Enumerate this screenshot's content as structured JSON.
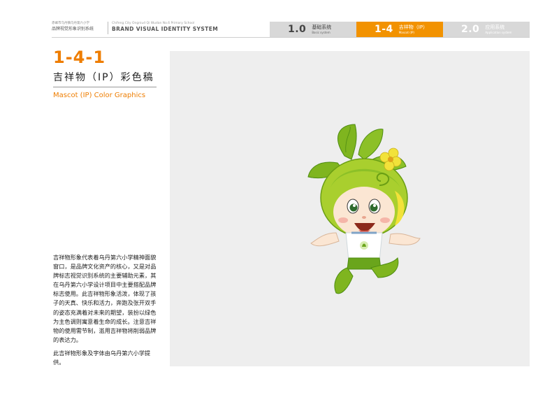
{
  "header": {
    "school_line": "赤峰市乌丹镇乌丹第六小学",
    "system_cn": "品牌视觉形象识别系统",
    "school_en": "Chifeng City Ongniud Qi Wudan No.6 Primary School",
    "system_en": "BRAND VISUAL IDENTITY SYSTEM",
    "tabs": [
      {
        "num": "1.0",
        "cn": "基础系统",
        "en": "Basic system",
        "active": false
      },
      {
        "num": "1-4",
        "cn": "吉祥物（IP）",
        "en": "Mascot (IP)",
        "active": true
      },
      {
        "num": "2.0",
        "cn": "应用系统",
        "en": "Application system",
        "active": false
      }
    ],
    "accent_color": "#f29200",
    "inactive_color": "#d8d8d8"
  },
  "section": {
    "number": "1-4-1",
    "title_cn": "吉祥物（IP）彩色稿",
    "title_en": "Mascot (IP) Color Graphics"
  },
  "description": {
    "paragraph1": "吉祥物形象代表着乌丹第六小学精神面貌窗口，是品牌文化资产的核心，又是对品牌标志视觉识别系统的主要辅助元素，其在乌丹第六小学设计项目中主要搭配品牌标志使用。此吉祥物形象活泼，体现了孩子的天真、快乐和活力，奔跑及张开双手的姿态充满着对未来的期望，装扮以绿色为主色调则寓意着生命的成长。注意吉祥物的使用需节制，滥用吉祥物将削弱品牌的表达力。",
    "paragraph2": "此吉祥物形象及字体由乌丹第六小学提供。"
  },
  "mascot": {
    "icon": "leaf-sprite-mascot-illustration",
    "colors": {
      "leaf": "#7fb51f",
      "leaf_dark": "#4e8c12",
      "hood": "#a9cf2e",
      "flower": "#f2e23a",
      "skin": "#fbe6d3",
      "shirt": "#ffffff",
      "pants": "#6aa51c"
    }
  }
}
